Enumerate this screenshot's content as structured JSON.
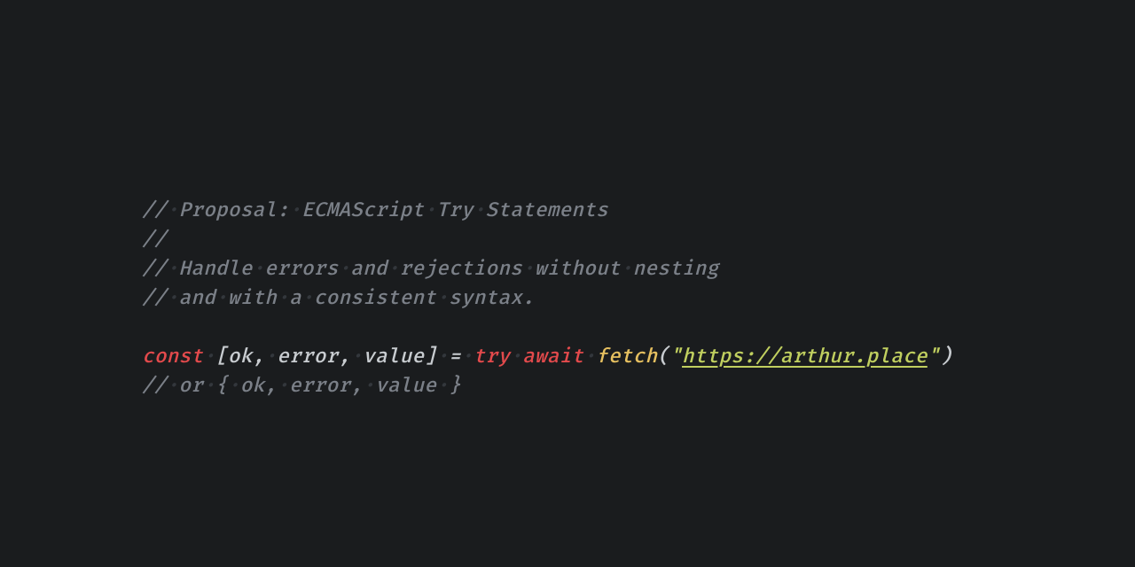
{
  "ws": "·",
  "comment1": "// Proposal: ECMAScript Try Statements",
  "comment1_tokens": [
    "//",
    "Proposal:",
    "ECMAScript",
    "Try",
    "Statements"
  ],
  "comment2": "//",
  "comment3_tokens": [
    "//",
    "Handle",
    "errors",
    "and",
    "rejections",
    "without",
    "nesting"
  ],
  "comment4_tokens": [
    "//",
    "and",
    "with",
    "a",
    "consistent",
    "syntax."
  ],
  "code": {
    "const": "const",
    "open_bracket": "[",
    "ids": [
      "ok",
      "error",
      "value"
    ],
    "comma": ",",
    "close_bracket": "]",
    "eq": "=",
    "try": "try",
    "await": "await",
    "fn": "fetch",
    "open_paren": "(",
    "quote": "\"",
    "url": "https://arthur.place",
    "close_paren": ")"
  },
  "comment5_tokens": [
    "//",
    "or",
    "{",
    "ok,",
    "error,",
    "value",
    "}"
  ]
}
